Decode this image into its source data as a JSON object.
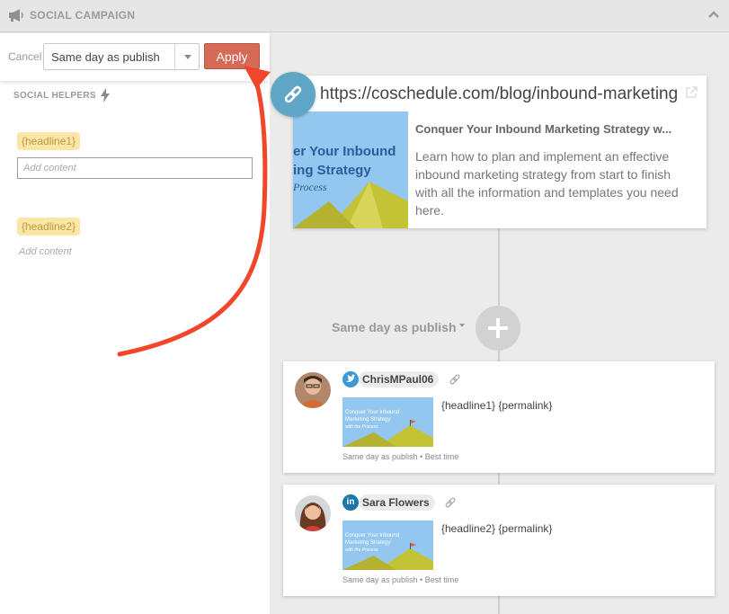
{
  "header": {
    "title": "SOCIAL CAMPAIGN"
  },
  "toolbar": {
    "cancel_label": "Cancel",
    "schedule_value": "Same day as publish",
    "apply_label": "Apply"
  },
  "helpers": {
    "title": "SOCIAL HELPERS",
    "items": [
      {
        "tag": "{headline1}",
        "placeholder": "Add content"
      },
      {
        "tag": "{headline2}",
        "placeholder": "Add content"
      }
    ]
  },
  "link_preview": {
    "url": "https://coschedule.com/blog/inbound-marketing",
    "title": "Conquer Your Inbound Marketing Strategy w...",
    "description": "Learn how to plan and implement an effective inbound marketing strategy from start to finish with all the information and templates you need here.",
    "thumb_line1": "er Your Inbound",
    "thumb_line2": "ing Strategy",
    "thumb_line3": "Process"
  },
  "schedule": {
    "label": "Same day as publish"
  },
  "posts": [
    {
      "network": "twitter",
      "username": "ChrisMPaul06",
      "text": "{headline1} {permalink}",
      "meta": "Same day as publish • Best time",
      "thumb": [
        "Conquer Your Inbound",
        "Marketing Strategy",
        "with the Process"
      ]
    },
    {
      "network": "linkedin",
      "network_glyph": "in",
      "username": "Sara Flowers",
      "text": "{headline2} {permalink}",
      "meta": "Same day as publish • Best time",
      "thumb": [
        "Conquer Your Inbound",
        "Marketing Strategy",
        "with the Process"
      ]
    }
  ],
  "colors": {
    "apply": "#d76a56",
    "link_badge": "#5fa6c6",
    "twitter": "#3a9ad9",
    "linkedin": "#1a77a8",
    "tag_bg": "#fbe6a6",
    "annotation_arrow": "#f2462a"
  },
  "icons": {
    "header": "megaphone-icon",
    "collapse": "chevron-up-icon",
    "helpers": "lightning-bolt-icon",
    "link": "chain-link-icon",
    "external": "external-link-icon",
    "add": "plus-icon"
  }
}
